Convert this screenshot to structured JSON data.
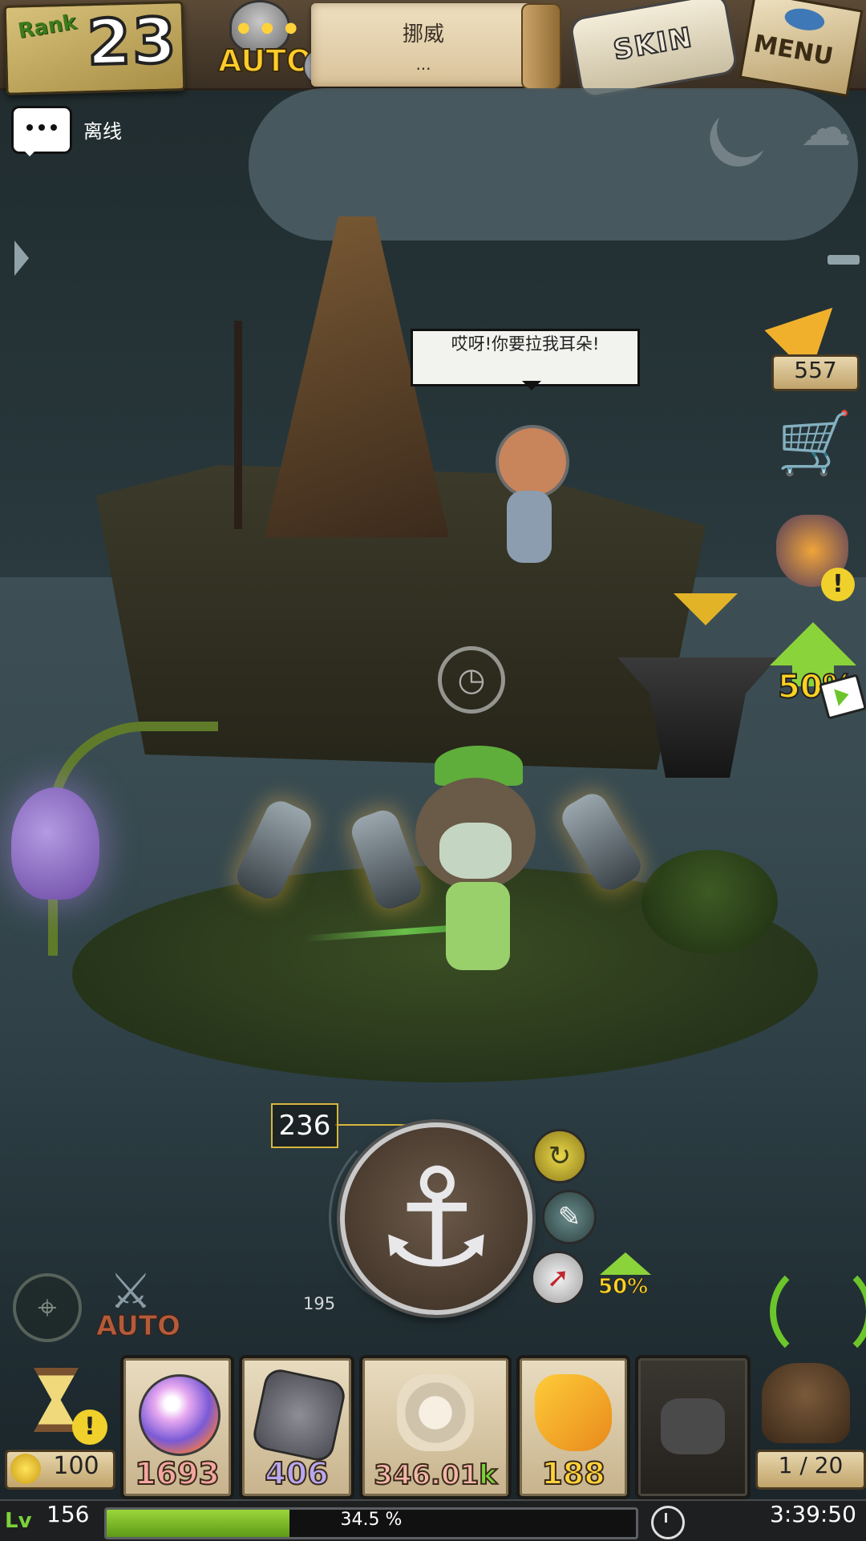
{
  "hud": {
    "rank_label": "Rank",
    "rank_value": "23",
    "auto_label": "AUTO",
    "location_name": "挪威",
    "location_sub": "...",
    "skin_label": "SKIN",
    "menu_label": "MENU"
  },
  "status": {
    "offline_label": "离线"
  },
  "npc": {
    "speech": "哎呀!你要拉我耳朵!"
  },
  "right_panel": {
    "candy_count": "557",
    "boost_label": "50%"
  },
  "fishing": {
    "depth_current": "236",
    "depth_min": "195",
    "small_boost_label": "50%"
  },
  "controls": {
    "auto_battle_label": "AUTO"
  },
  "inventory": {
    "hourglass_count": "100",
    "hourglass_badge": "!",
    "slots": [
      {
        "name": "pearl",
        "value": "1693"
      },
      {
        "name": "shield-medal",
        "value": "406"
      },
      {
        "name": "shell",
        "value_main": "346.01",
        "value_suffix": "k"
      },
      {
        "name": "amber",
        "value": "188"
      },
      {
        "name": "locked",
        "value": ""
      }
    ],
    "bag_count": "1 / 20"
  },
  "statusbar": {
    "level_icon": "Lv",
    "level": "156",
    "xp_percent": 34.5,
    "xp_text": "34.5 %",
    "time": "3:39:50"
  },
  "colors": {
    "accent_green": "#7ad23a",
    "accent_yellow": "#ffd21f",
    "xp_fill": "#9ad63a"
  }
}
